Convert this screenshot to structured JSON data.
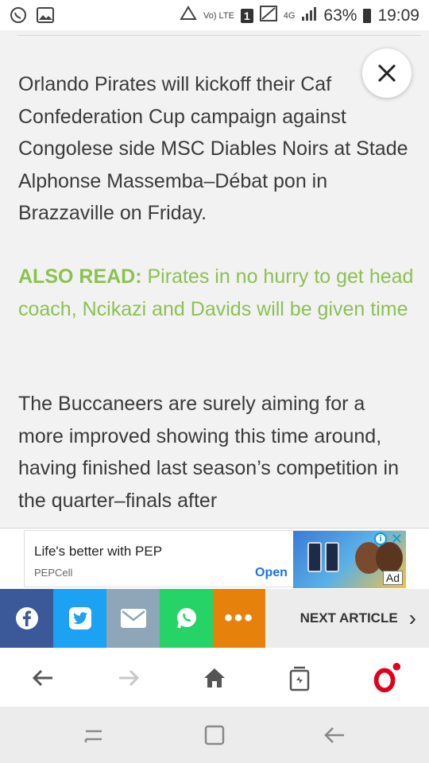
{
  "status_bar": {
    "battery_text": "63%",
    "time": "19:09",
    "network": "4G",
    "volte": "Vo) LTE",
    "sim_badge": "1"
  },
  "article": {
    "paragraph1": "Orlando Pirates will kickoff their Caf Confederation Cup campaign against Congolese side MSC Diables Noirs at Stade Alphonse Massemba–Débat pon in Brazzaville on Friday.",
    "also_read_label": "ALSO READ:",
    "also_read_link": " Pirates in no hurry to get head coach, Ncikazi and Davids will be given time",
    "paragraph3": "The Buccaneers are surely aiming for a more improved showing this time around, having finished last season’s competition in the quarter–finals after",
    "link_color": "#8cc152"
  },
  "ad": {
    "title": "Life's better with PEP",
    "advertiser": "PEPCell",
    "cta": "Open",
    "tag": "Ad"
  },
  "share_bar": {
    "facebook_color": "#3b5998",
    "twitter_color": "#1da1f2",
    "email_color": "#8fa6b8",
    "whatsapp_color": "#25d366",
    "more_color": "#e6820c",
    "more_label": "•••",
    "next_label": "NEXT ARTICLE",
    "next_chevron": "›"
  },
  "browser_bar": {
    "back_icon": "arrow-left-icon",
    "forward_icon": "arrow-right-icon",
    "home_icon": "home-icon",
    "tabs_icon": "tabs-icon",
    "opera_icon": "opera-icon"
  }
}
